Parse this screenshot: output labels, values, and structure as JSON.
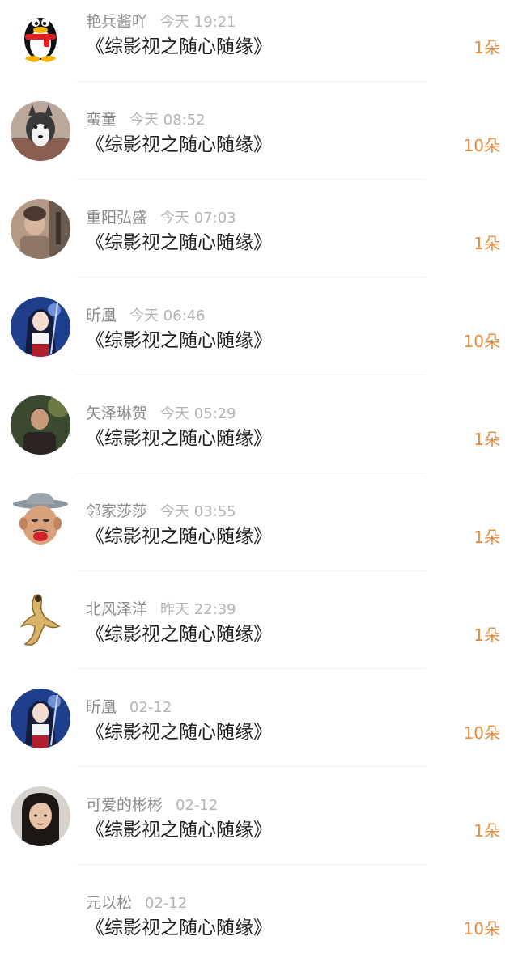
{
  "gifts": [
    {
      "name": "艳兵酱吖",
      "time": "今天 19:21",
      "title": "《综影视之随心随缘》",
      "count": "1朵",
      "avatar": "qq-penguin-avatar"
    },
    {
      "name": "蛮童",
      "time": "今天 08:52",
      "title": "《综影视之随心随缘》",
      "count": "10朵",
      "avatar": "husky-dog-avatar"
    },
    {
      "name": "重阳弘盛",
      "time": "今天 07:03",
      "title": "《综影视之随心随缘》",
      "count": "1朵",
      "avatar": "photo-avatar"
    },
    {
      "name": "昕凰",
      "time": "今天 06:46",
      "title": "《综影视之随心随缘》",
      "count": "10朵",
      "avatar": "anime-girl-avatar"
    },
    {
      "name": "矢泽琳贺",
      "time": "今天 05:29",
      "title": "《综影视之随心随缘》",
      "count": "1朵",
      "avatar": "person-photo-avatar"
    },
    {
      "name": "邻家莎莎",
      "time": "今天 03:55",
      "title": "《综影视之随心随缘》",
      "count": "1朵",
      "avatar": "cartoon-man-avatar"
    },
    {
      "name": "北风泽洋",
      "time": "昨天 22:39",
      "title": "《综影视之随心随缘》",
      "count": "1朵",
      "avatar": "sketch-figure-avatar"
    },
    {
      "name": "昕凰",
      "time": "02-12",
      "title": "《综影视之随心随缘》",
      "count": "10朵",
      "avatar": "anime-girl-avatar"
    },
    {
      "name": "可爱的彬彬",
      "time": "02-12",
      "title": "《综影视之随心随缘》",
      "count": "1朵",
      "avatar": "selfie-avatar"
    },
    {
      "name": "元以松",
      "time": "02-12",
      "title": "《综影视之随心随缘》",
      "count": "10朵",
      "avatar": "blank-avatar"
    }
  ],
  "colors": {
    "accent": "#e98a3b",
    "name": "#8a8a8a",
    "time": "#b3b3b3",
    "title": "#1e1e1e",
    "divider": "#eeeeee"
  }
}
